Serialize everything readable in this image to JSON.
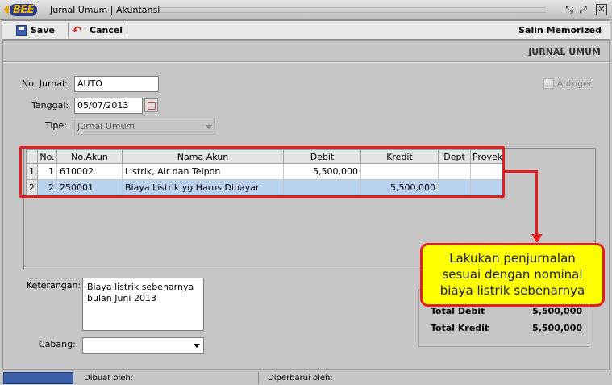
{
  "window": {
    "logo_text": "BEE",
    "title": "Jurnal Umum | Akuntansi",
    "buttons": [
      "restore-icon",
      "maximize-icon",
      "close-icon"
    ]
  },
  "toolbar": {
    "save_label": "Save",
    "cancel_label": "Cancel",
    "salin_label": "Salin Memorized"
  },
  "form": {
    "section_title": "JURNAL UMUM",
    "no_jurnal_label": "No. Jurnal:",
    "no_jurnal_value": "AUTO",
    "tanggal_label": "Tanggal:",
    "tanggal_value": "05/07/2013",
    "tipe_label": "Tipe:",
    "tipe_value": "Jurnal Umum",
    "autogen_label": "Autogen",
    "autogen_checked": false
  },
  "grid": {
    "columns": [
      "No.",
      "No.Akun",
      "Nama Akun",
      "Debit",
      "Kredit",
      "Dept",
      "Proyek"
    ],
    "rows": [
      {
        "rownum": "1",
        "no": "1",
        "akun": "610002",
        "nama": "Listrik, Air dan Telpon",
        "debit": "5,500,000",
        "kredit": "",
        "dept": "",
        "proyek": ""
      },
      {
        "rownum": "2",
        "no": "2",
        "akun": "250001",
        "nama": "Biaya Listrik yg Harus Dibayar",
        "debit": "",
        "kredit": "5,500,000",
        "dept": "",
        "proyek": ""
      }
    ]
  },
  "footer": {
    "keterangan_label": "Keterangan:",
    "keterangan_line1": "Biaya listrik sebenarnya",
    "keterangan_line2": "bulan Juni 2013",
    "cabang_label": "Cabang:",
    "cabang_value": "",
    "total_debit_label": "Total Debit",
    "total_debit_value": "5,500,000",
    "total_kredit_label": "Total Kredit",
    "total_kredit_value": "5,500,000"
  },
  "callout": {
    "line1": "Lakukan penjurnalan",
    "line2": "sesuai dengan nominal",
    "line3": "biaya listrik sebenarnya"
  },
  "status": {
    "dibuat_label": "Dibuat oleh:",
    "diperbarui_label": "Diperbarui oleh:"
  },
  "colors": {
    "highlight_red": "#e02020",
    "callout_yellow": "#ffff00",
    "selected_row": "#b8d2f0"
  }
}
